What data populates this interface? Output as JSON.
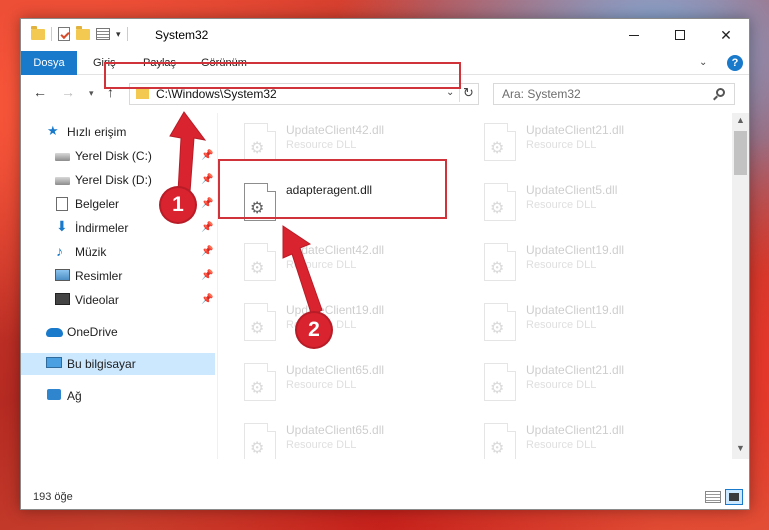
{
  "window": {
    "title": "System32",
    "minimize_icon": "minimize-icon",
    "maximize_icon": "maximize-icon",
    "close_glyph": "✕"
  },
  "ribbon": {
    "tabs": [
      {
        "label": "Dosya",
        "active": true
      },
      {
        "label": "Giriş",
        "active": false
      },
      {
        "label": "Paylaş",
        "active": false
      },
      {
        "label": "Görünüm",
        "active": false
      }
    ],
    "help_glyph": "?"
  },
  "address": {
    "path": "C:\\Windows\\System32",
    "search_placeholder": "Ara: System32"
  },
  "sidebar": {
    "items": [
      {
        "label": "Hızlı erişim",
        "icon": "star-icon",
        "pinned": false
      },
      {
        "label": "Yerel Disk (C:)",
        "icon": "disk-icon",
        "pinned": true
      },
      {
        "label": "Yerel Disk (D:)",
        "icon": "disk-icon",
        "pinned": true
      },
      {
        "label": "Belgeler",
        "icon": "document-icon",
        "pinned": true
      },
      {
        "label": "İndirmeler",
        "icon": "download-icon",
        "pinned": true
      },
      {
        "label": "Müzik",
        "icon": "music-icon",
        "pinned": true
      },
      {
        "label": "Resimler",
        "icon": "pictures-icon",
        "pinned": true
      },
      {
        "label": "Videolar",
        "icon": "video-icon",
        "pinned": true
      },
      {
        "label": "OneDrive",
        "icon": "cloud-icon",
        "pinned": false
      },
      {
        "label": "Bu bilgisayar",
        "icon": "computer-icon",
        "pinned": false,
        "selected": true
      },
      {
        "label": "Ağ",
        "icon": "network-icon",
        "pinned": false
      }
    ]
  },
  "files": [
    {
      "name": "UpdateClient42.dll",
      "type": "Resource DLL",
      "faded": true
    },
    {
      "name": "UpdateClient21.dll",
      "type": "Resource DLL",
      "faded": true
    },
    {
      "name": "adapteragent.dll",
      "type": "",
      "faded": false
    },
    {
      "name": "UpdateClient5.dll",
      "type": "Resource DLL",
      "faded": true
    },
    {
      "name": "UpdateClient42.dll",
      "type": "Resource DLL",
      "faded": true
    },
    {
      "name": "UpdateClient19.dll",
      "type": "Resource DLL",
      "faded": true
    },
    {
      "name": "UpdateClient19.dll",
      "type": "Resource DLL",
      "faded": true
    },
    {
      "name": "UpdateClient19.dll",
      "type": "Resource DLL",
      "faded": true
    },
    {
      "name": "UpdateClient65.dll",
      "type": "Resource DLL",
      "faded": true
    },
    {
      "name": "UpdateClient21.dll",
      "type": "Resource DLL",
      "faded": true
    },
    {
      "name": "UpdateClient65.dll",
      "type": "Resource DLL",
      "faded": true
    },
    {
      "name": "UpdateClient21.dll",
      "type": "Resource DLL",
      "faded": true
    }
  ],
  "status": {
    "count": "193 öğe"
  },
  "annotations": {
    "step1": "1",
    "step2": "2",
    "highlight_color": "#d0333a",
    "callout_color": "#d9232f"
  },
  "colors": {
    "accent": "#1979ca",
    "selection": "#cce8ff"
  }
}
